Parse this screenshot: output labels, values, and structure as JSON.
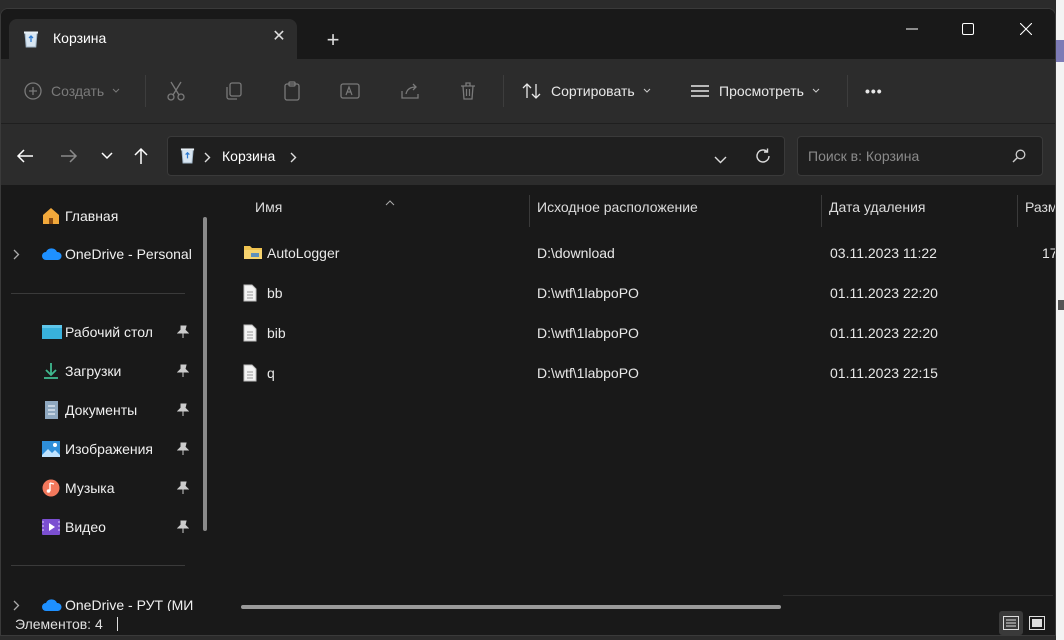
{
  "tab": {
    "title": "Корзина",
    "close": "✕",
    "new_tab": "+"
  },
  "toolbar": {
    "create_label": "Создать",
    "sort_label": "Сортировать",
    "view_label": "Просмотреть",
    "more": "•••"
  },
  "address": {
    "crumb": "Корзина"
  },
  "search": {
    "placeholder": "Поиск в: Корзина"
  },
  "sidebar": {
    "items": [
      {
        "label": "Главная"
      },
      {
        "label": "OneDrive - Personal"
      },
      {
        "label": "Рабочий стол"
      },
      {
        "label": "Загрузки"
      },
      {
        "label": "Документы"
      },
      {
        "label": "Изображения"
      },
      {
        "label": "Музыка"
      },
      {
        "label": "Видео"
      },
      {
        "label": "OneDrive - РУТ (МИ"
      }
    ]
  },
  "columns": {
    "name": "Имя",
    "origin": "Исходное расположение",
    "deleted": "Дата удаления",
    "size": "Разм"
  },
  "rows": [
    {
      "name": "AutoLogger",
      "origin": "D:\\download",
      "deleted": "03.11.2023 11:22",
      "size": "17",
      "type": "folder"
    },
    {
      "name": "bb",
      "origin": "D:\\wtf\\1labpoPO",
      "deleted": "01.11.2023 22:20",
      "size": "",
      "type": "file"
    },
    {
      "name": "bib",
      "origin": "D:\\wtf\\1labpoPO",
      "deleted": "01.11.2023 22:20",
      "size": "",
      "type": "file"
    },
    {
      "name": "q",
      "origin": "D:\\wtf\\1labpoPO",
      "deleted": "01.11.2023 22:15",
      "size": "",
      "type": "file"
    }
  ],
  "status": {
    "items_text": "Элементов: 4"
  },
  "colors": {
    "window_bg": "#191919",
    "toolbar_bg": "#2c2c2c",
    "folder": "#f0c350",
    "onedrive": "#1e90ff"
  }
}
